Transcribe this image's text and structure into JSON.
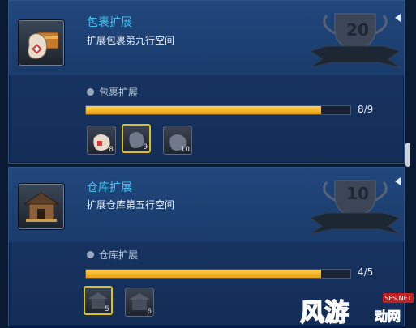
{
  "panels": [
    {
      "title": "包裹扩展",
      "desc": "扩展包裹第九行空间",
      "trophy": "20",
      "sub": "包裹扩展",
      "progress": "8/9",
      "progress_fraction": 0.889,
      "slots": [
        {
          "n": "8",
          "kind": "bag"
        },
        {
          "n": "9",
          "kind": "bag-locked"
        },
        {
          "n": "10",
          "kind": "bag-locked"
        }
      ]
    },
    {
      "title": "仓库扩展",
      "desc": "扩展仓库第五行空间",
      "trophy": "10",
      "sub": "仓库扩展",
      "progress": "4/5",
      "progress_fraction": 0.8,
      "slots": [
        {
          "n": "5",
          "kind": "house"
        },
        {
          "n": "6",
          "kind": "house"
        }
      ]
    }
  ],
  "watermark": {
    "site": "SFS.NET"
  }
}
